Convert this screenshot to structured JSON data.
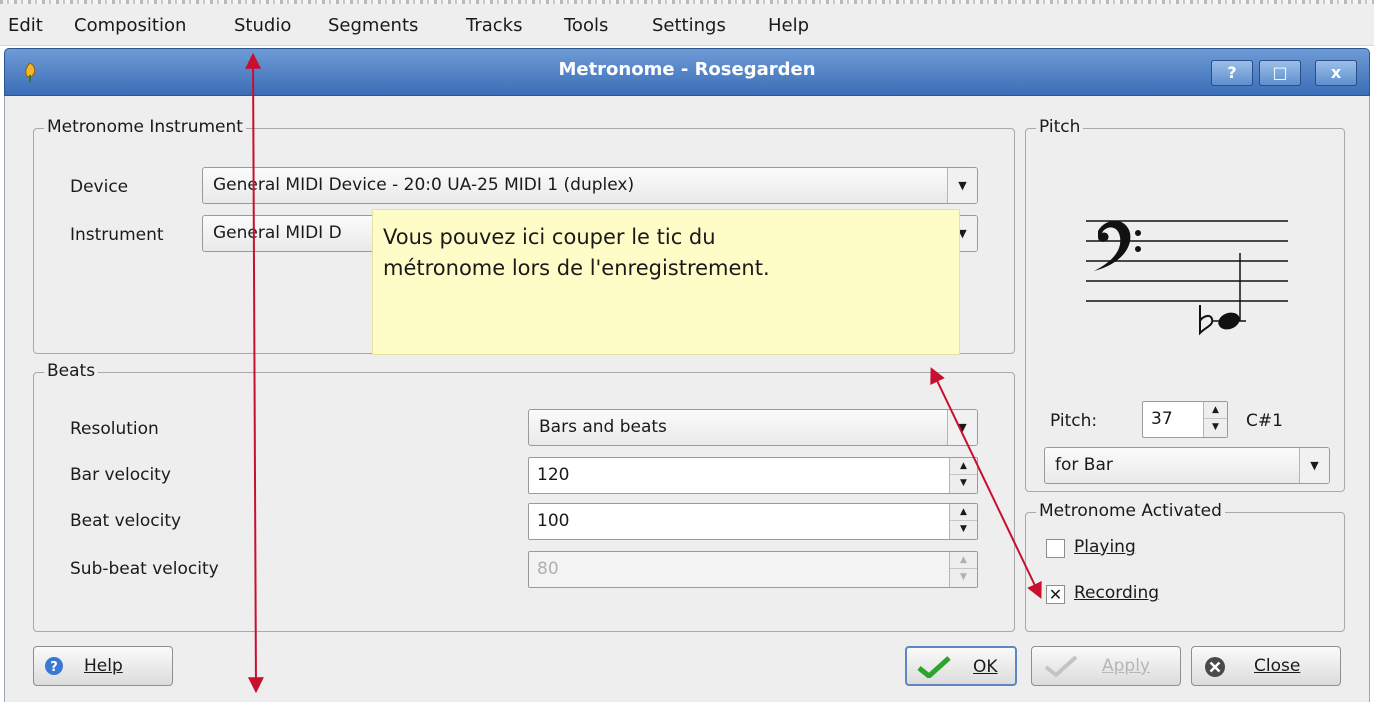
{
  "menubar": {
    "items": [
      "Edit",
      "Composition",
      "Studio",
      "Segments",
      "Tracks",
      "Tools",
      "Settings",
      "Help"
    ]
  },
  "window": {
    "title": "Metronome - Rosegarden",
    "help_btn": "?",
    "maximize_btn": "□",
    "close_btn": "x"
  },
  "instrument_group": {
    "title": "Metronome Instrument",
    "device_label": "Device",
    "device_value": "General MIDI Device - 20:0 UA-25 MIDI 1 (duplex)",
    "instrument_label": "Instrument",
    "instrument_value": "General MIDI D"
  },
  "tooltip": {
    "line1": "Vous pouvez ici couper le tic du",
    "line2": "métronome lors de l'enregistrement."
  },
  "beats_group": {
    "title": "Beats",
    "resolution_label": "Resolution",
    "resolution_value": "Bars and beats",
    "bar_velocity_label": "Bar velocity",
    "bar_velocity_value": "120",
    "beat_velocity_label": "Beat velocity",
    "beat_velocity_value": "100",
    "subbeat_velocity_label": "Sub-beat velocity",
    "subbeat_velocity_value": "80"
  },
  "pitch_group": {
    "title": "Pitch",
    "pitch_label": "Pitch:",
    "pitch_value": "37",
    "note_name": "C#1",
    "for_value": "for Bar"
  },
  "activated_group": {
    "title": "Metronome Activated",
    "playing_label": "Playing",
    "playing_checked": false,
    "recording_label": "Recording",
    "recording_checked": true,
    "recording_mark": "✕"
  },
  "buttons": {
    "help": "Help",
    "ok": "OK",
    "apply": "Apply",
    "close": "Close"
  },
  "colors": {
    "annotation_arrow": "#c8102e",
    "titlebar": "#4a7cc4",
    "tooltip_bg": "#fffdc7"
  }
}
